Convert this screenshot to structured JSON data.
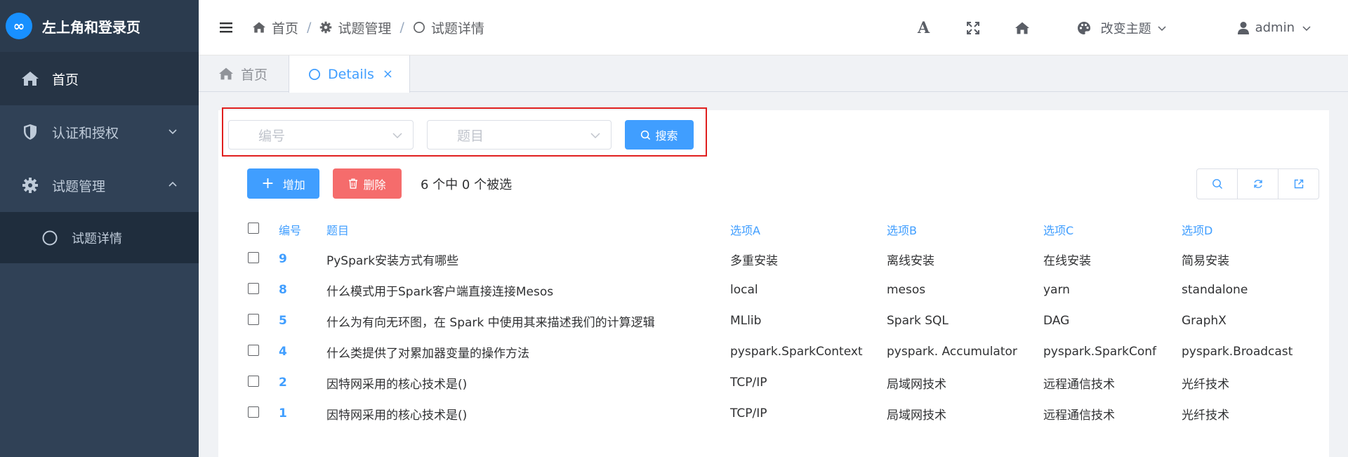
{
  "app": {
    "title": "左上角和登录页",
    "logo_glyph": "∞",
    "accent": "#409eff"
  },
  "sidebar": {
    "items": [
      {
        "label": "首页",
        "icon": "home-icon"
      },
      {
        "label": "认证和授权",
        "icon": "shield-icon"
      },
      {
        "label": "试题管理",
        "icon": "gear-icon"
      }
    ],
    "subitems": [
      {
        "label": "试题详情",
        "icon": "circle-icon"
      }
    ]
  },
  "header": {
    "breadcrumb": [
      {
        "label": "首页",
        "icon": "home-icon"
      },
      {
        "label": "试题管理",
        "icon": "gear-icon"
      },
      {
        "label": "试题详情",
        "icon": "circle-icon"
      }
    ],
    "separator": "/",
    "font_size_icon": "A",
    "theme_label": "改变主题",
    "user_name": "admin"
  },
  "tabs": [
    {
      "label": "首页",
      "icon": "home-icon",
      "active": false
    },
    {
      "label": "Details",
      "icon": "circle-icon",
      "active": true,
      "close": "×"
    }
  ],
  "filters": {
    "id_placeholder": "编号",
    "question_placeholder": "题目",
    "search_label": "搜索"
  },
  "toolbar": {
    "add_label": "增加",
    "delete_label": "删除",
    "selection_info": "6 个中 0 个被选"
  },
  "table": {
    "headers": [
      "编号",
      "题目",
      "选项A",
      "选项B",
      "选项C",
      "选项D"
    ],
    "rows": [
      [
        "9",
        "PySpark安装方式有哪些",
        "多重安装",
        "离线安装",
        "在线安装",
        "简易安装"
      ],
      [
        "8",
        "什么模式用于Spark客户端直接连接Mesos",
        "local",
        "mesos",
        "yarn",
        "standalone"
      ],
      [
        "5",
        "什么为有向无环图，在 Spark 中使用其来描述我们的计算逻辑",
        "MLlib",
        "Spark SQL",
        "DAG",
        "GraphX"
      ],
      [
        "4",
        "什么类提供了对累加器变量的操作方法",
        "pyspark.SparkContext",
        "pyspark. Accumulator",
        "pyspark.SparkConf",
        "pyspark.Broadcast"
      ],
      [
        "2",
        "因特网采用的核心技术是()",
        "TCP/IP",
        "局域网技术",
        "远程通信技术",
        "光纤技术"
      ],
      [
        "1",
        "因特网采用的核心技术是()",
        "TCP/IP",
        "局域网技术",
        "远程通信技术",
        "光纤技术"
      ]
    ]
  }
}
